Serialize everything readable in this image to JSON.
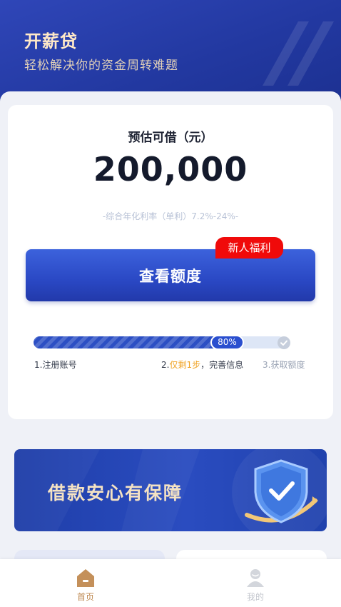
{
  "header": {
    "title": "开薪贷",
    "subtitle": "轻松解决你的资金周转难题"
  },
  "loan_card": {
    "estimate_label": "预估可借（元）",
    "amount": "200,000",
    "rate_note": "-综合年化利率（单利）7.2%-24%-",
    "cta_label": "查看额度",
    "badge": "新人福利"
  },
  "progress": {
    "percent": 0.8,
    "percent_label": "80%",
    "steps": {
      "step1": "1.注册账号",
      "step2_prefix": "2.",
      "step2_highlight": "仅剩1步",
      "step2_suffix": "，完善信息",
      "step3": "3.获取额度"
    }
  },
  "banner": {
    "text": "借款安心有保障"
  },
  "tabbar": {
    "tabs": [
      {
        "label": "首页",
        "icon": "home-icon",
        "active": true
      },
      {
        "label": "我的",
        "icon": "user-icon",
        "active": false
      }
    ]
  },
  "colors": {
    "brand_blue": "#2a48c4",
    "header_blue": "#2238a0",
    "badge_red": "#f00a0a",
    "highlight_orange": "#f0a324",
    "tab_active": "#bf8a52"
  }
}
